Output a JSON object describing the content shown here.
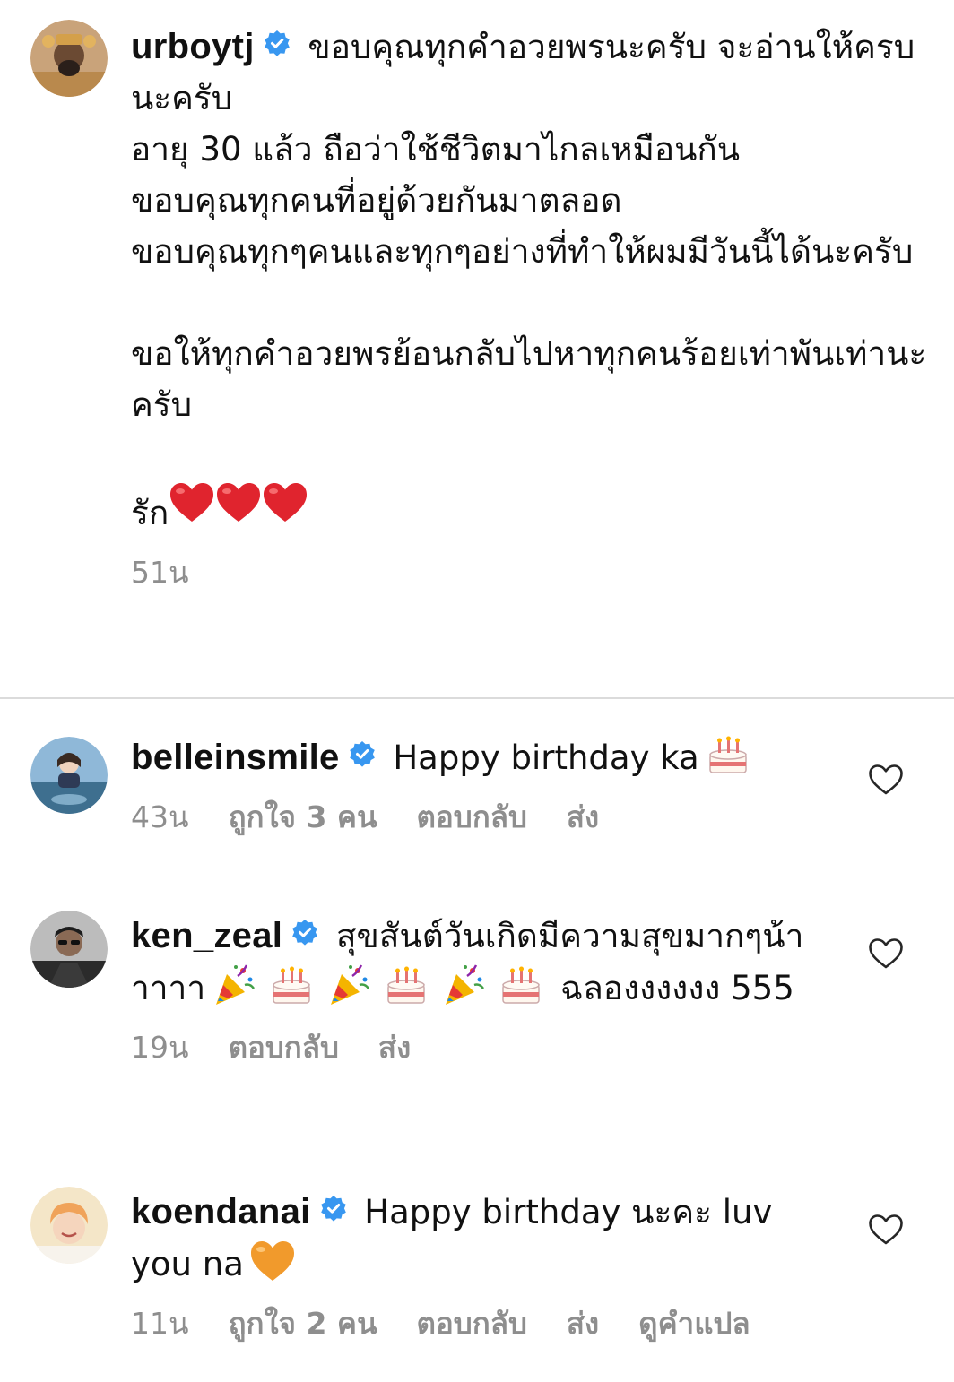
{
  "caption": {
    "username": "urboytj",
    "text": "ขอบคุณทุกคำอวยพรนะครับ จะอ่านให้ครบนะครับ\nอายุ 30 แล้ว ถือว่าใช้ชีวิตมาไกลเหมือนกัน\nขอบคุณทุกคนที่อยู่ด้วยกันมาตลอด\nขอบคุณทุกๆคนและทุกๆอย่างที่ทำให้ผมมีวันนี้ได้นะครับ\n\nขอให้ทุกคำอวยพรย้อนกลับไปหาทุกคนร้อยเท่าพันเท่านะครับ\n\n",
    "last_line": "รัก",
    "time": "51น",
    "avatar_icon": "avatar-image",
    "verified_icon": "verified-badge-icon"
  },
  "comments": [
    {
      "username": "belleinsmile",
      "text": "Happy birthday ka",
      "time": "43น",
      "likes": "ถูกใจ 3 คน",
      "reply_label": "ตอบกลับ",
      "send_label": "ส่ง",
      "emoji": [
        "birthday-cake"
      ]
    },
    {
      "username": "ken_zeal",
      "text_part1": "สุขสันต์วันเกิดมีความสุขมากๆน้าาาาา",
      "text_part2": "ฉลองงงงงง 555",
      "time": "19น",
      "reply_label": "ตอบกลับ",
      "send_label": "ส่ง",
      "emoji": [
        "party-popper",
        "birthday-cake",
        "party-popper",
        "birthday-cake",
        "party-popper",
        "birthday-cake"
      ]
    },
    {
      "username": "koendanai",
      "text": "Happy birthday นะคะ luv you na",
      "time": "11น",
      "likes": "ถูกใจ 2 คน",
      "reply_label": "ตอบกลับ",
      "send_label": "ส่ง",
      "translate_label": "ดูคำแปล",
      "emoji": [
        "orange-heart"
      ]
    }
  ],
  "colors": {
    "meta_text": "#8e8e8e",
    "verified_blue": "#3897f0",
    "divider": "#dbdbdb",
    "heart_red": "#e0242e",
    "orange_heart": "#f19a2c"
  }
}
